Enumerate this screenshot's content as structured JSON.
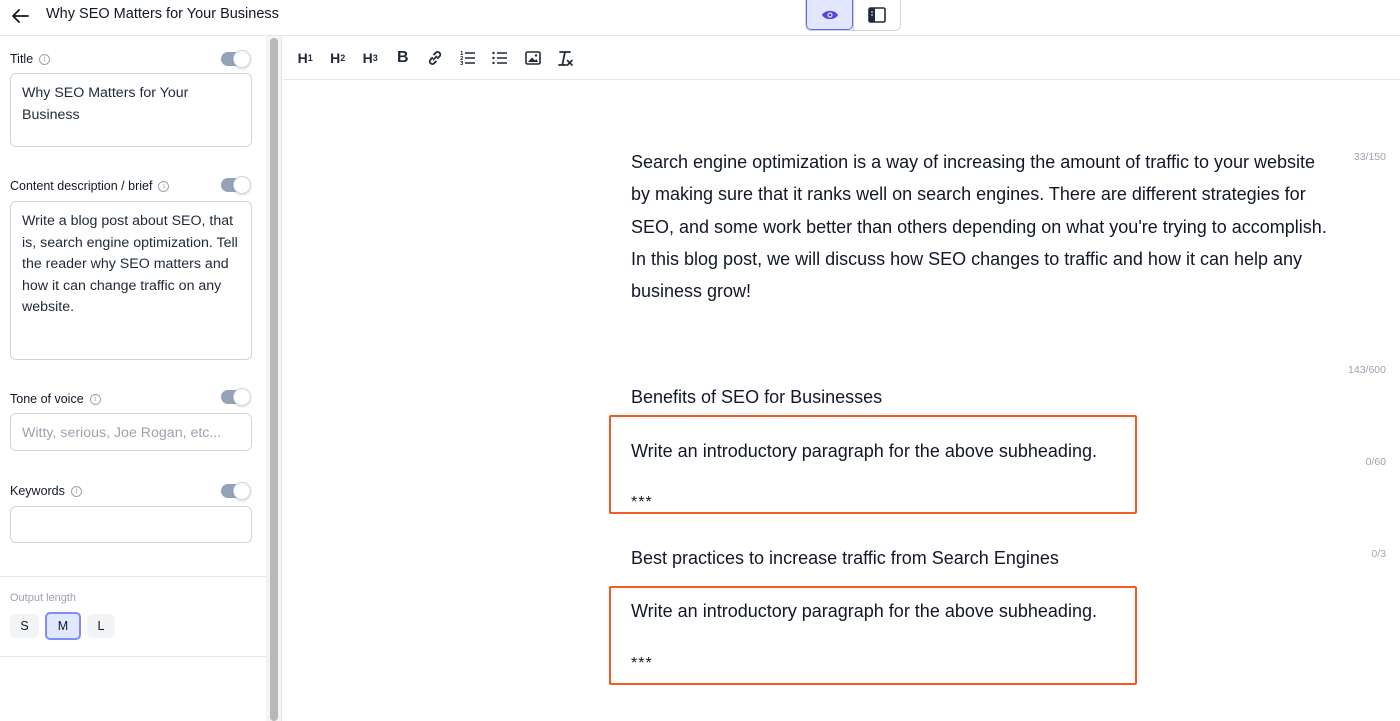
{
  "header": {
    "doc_title": "Why SEO Matters for Your Business",
    "back_icon": "arrow-left-icon",
    "view_buttons": [
      {
        "icon": "eye-icon",
        "active": true
      },
      {
        "icon": "sidebar-panel-icon",
        "active": false
      }
    ]
  },
  "sidebar": {
    "title_field": {
      "label": "Title",
      "value": "Why SEO Matters for Your Business",
      "counter": "33/150",
      "toggle_on": true
    },
    "description_field": {
      "label": "Content description / brief",
      "value": "Write a blog post about SEO, that is, search engine optimization. Tell the reader why SEO matters and how it can change traffic on any website.",
      "counter": "143/600",
      "toggle_on": true
    },
    "tone_field": {
      "label": "Tone of voice",
      "placeholder": "Witty, serious, Joe Rogan, etc...",
      "value": "",
      "counter": "0/60",
      "toggle_on": true
    },
    "keywords_field": {
      "label": "Keywords",
      "value": "",
      "counter": "0/3",
      "toggle_on": true
    },
    "output_length": {
      "label": "Output length",
      "options": [
        "S",
        "M",
        "L"
      ],
      "selected": "M"
    }
  },
  "toolbar": {
    "buttons": [
      {
        "name": "heading-1-button",
        "label": "H",
        "sub": "1"
      },
      {
        "name": "heading-2-button",
        "label": "H",
        "sub": "2"
      },
      {
        "name": "heading-3-button",
        "label": "H",
        "sub": "3"
      },
      {
        "name": "bold-button",
        "label": "B",
        "sub": ""
      }
    ],
    "icons": [
      "link-icon",
      "ordered-list-icon",
      "bullet-list-icon",
      "image-icon",
      "clear-format-icon"
    ]
  },
  "editor": {
    "intro_paragraph": "Search engine optimization is a way of increasing the amount of traffic to your website by making sure that it ranks well on search engines. There are different strategies for SEO, and some work better than others depending on what you're trying to accomplish. In this blog post, we will discuss how SEO changes to traffic and how it can help any business grow!",
    "sections": [
      {
        "heading": "Benefits of SEO for Businesses",
        "prompt": "Write an introductory paragraph for the above subheading.",
        "separator": "***"
      },
      {
        "heading": "Best practices to increase traffic from Search Engines",
        "prompt": "Write an introductory paragraph for the above subheading.",
        "separator": "***"
      }
    ],
    "highlight_color": "#f15a24"
  },
  "colors": {
    "accent": "#6366f1",
    "accent_bg": "#e0e7ff",
    "border": "#e5e7eb",
    "muted_text": "#9ca3af"
  }
}
